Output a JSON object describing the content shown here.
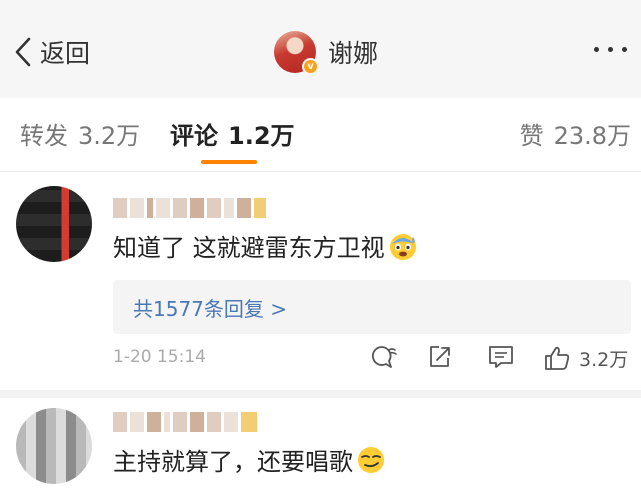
{
  "nav": {
    "back_label": "返回",
    "title": "谢娜",
    "icons": [
      "back-chevron-icon",
      "verified-badge-icon",
      "more-dots-icon"
    ]
  },
  "tabs": {
    "repost_label": "转发",
    "repost_count": "3.2万",
    "comment_label": "评论",
    "comment_count": "1.2万",
    "like_label": "赞",
    "like_count": "23.8万",
    "active": "comment",
    "indicator_color": "#ff8200"
  },
  "comments": [
    {
      "text": "知道了 这就避雷东方卫视",
      "emoji": "sweating-face-emoji",
      "replies_label": "共1577条回复 >",
      "time": "1-20 15:14",
      "like_count": "3.2万"
    },
    {
      "text": "主持就算了，还要唱歌",
      "emoji": "smirk-face-emoji"
    }
  ],
  "colors": {
    "link": "#4a78b3",
    "nav_background": "#f6f6f6",
    "muted_text": "#aaaaaa"
  }
}
